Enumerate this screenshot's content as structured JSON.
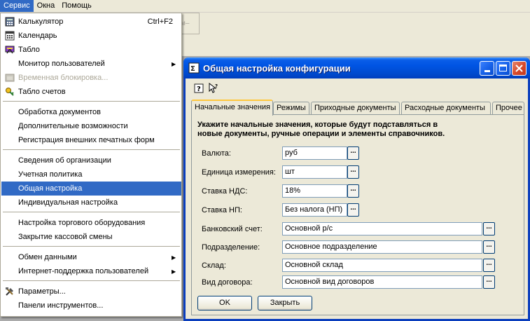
{
  "menubar": {
    "items": [
      {
        "label": "Сервис",
        "active": true
      },
      {
        "label": "Окна",
        "active": false
      },
      {
        "label": "Помощь",
        "active": false
      }
    ]
  },
  "background": {
    "toolbar_button_label": "м–"
  },
  "service_menu": {
    "items": [
      {
        "label": "Калькулятор",
        "shortcut": "Ctrl+F2",
        "icon": "calculator-icon"
      },
      {
        "label": "Календарь",
        "icon": "calendar-icon"
      },
      {
        "label": "Табло",
        "icon": "scoreboard-icon"
      },
      {
        "label": "Монитор пользователей",
        "submenu": true
      },
      {
        "label": "Временная блокировка...",
        "icon": "lock-icon",
        "disabled": true
      },
      {
        "label": "Табло счетов",
        "icon": "key-icon"
      },
      {
        "label": "Обработка документов"
      },
      {
        "label": "Дополнительные возможности"
      },
      {
        "label": "Регистрация внешних печатных форм"
      },
      {
        "label": "Сведения об организации"
      },
      {
        "label": "Учетная политика"
      },
      {
        "label": "Общая настройка",
        "highlighted": true
      },
      {
        "label": "Индивидуальная настройка"
      },
      {
        "label": "Настройка торгового оборудования"
      },
      {
        "label": "Закрытие кассовой смены"
      },
      {
        "label": "Обмен данными",
        "submenu": true
      },
      {
        "label": "Интернет-поддержка пользователей",
        "submenu": true
      },
      {
        "label": "Параметры...",
        "icon": "tools-icon"
      },
      {
        "label": "Панели инструментов..."
      }
    ]
  },
  "dialog": {
    "title": "Общая настройка конфигурации",
    "tabs": [
      {
        "label": "Начальные значения",
        "active": true
      },
      {
        "label": "Режимы"
      },
      {
        "label": "Приходные документы"
      },
      {
        "label": "Расходные документы"
      },
      {
        "label": "Прочее"
      }
    ],
    "hint_line1": "Укажите начальные значения, которые будут подставляться в",
    "hint_line2": "новые документы, ручные операции и элементы справочников.",
    "fields": [
      {
        "label": "Валюта:",
        "value": "руб"
      },
      {
        "label": "Единица измерения:",
        "value": "шт"
      },
      {
        "label": "Ставка НДС:",
        "value": "18%"
      },
      {
        "label": "Ставка НП:",
        "value": "Без налога (НП)"
      },
      {
        "label": "Банковский счет:",
        "value": "Основной р/с"
      },
      {
        "label": "Подразделение:",
        "value": "Основное подразделение"
      },
      {
        "label": "Склад:",
        "value": "Основной склад"
      },
      {
        "label": "Вид договора:",
        "value": "Основной вид договоров"
      }
    ],
    "pick_button_label": "...",
    "ok_label": "OK",
    "close_label": "Закрыть"
  },
  "colors": {
    "menu_highlight": "#316ac5",
    "titlebar": "#0054e3",
    "workspace": "#ababab",
    "dialog_face": "#ece9d8"
  }
}
